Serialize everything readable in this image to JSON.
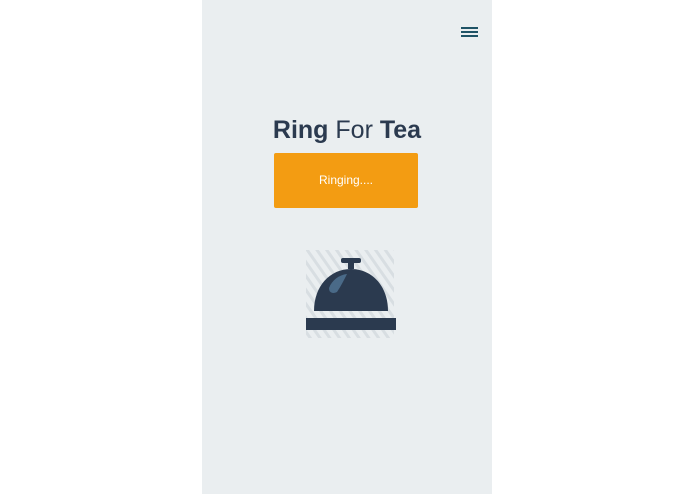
{
  "app": {
    "title_part_1": "Ring",
    "title_part_2": "For",
    "title_part_3": "Tea"
  },
  "menu": {
    "icon": "hamburger-menu-icon"
  },
  "ring_button": {
    "label": "Ringing...."
  },
  "bell": {
    "icon": "service-bell-icon"
  },
  "colors": {
    "background": "#eaeef0",
    "accent": "#f39c12",
    "text": "#2b3a4f",
    "icon": "#2b3a4f",
    "menu": "#1f5366"
  }
}
